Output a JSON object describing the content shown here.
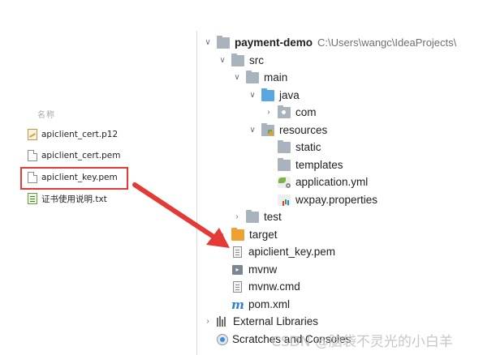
{
  "explorer": {
    "header": "名称",
    "files": [
      {
        "name": "apiclient_cert.p12",
        "icon": "certificate-icon"
      },
      {
        "name": "apiclient_cert.pem",
        "icon": "document-icon"
      },
      {
        "name": "apiclient_key.pem",
        "icon": "document-icon",
        "highlighted": true
      },
      {
        "name": "证书使用说明.txt",
        "icon": "text-file-icon"
      }
    ],
    "highlight_color": "#e53935"
  },
  "project": {
    "name": "payment-demo",
    "path": "C:\\Users\\wangc\\IdeaProjects\\",
    "items": {
      "src": "src",
      "main": "main",
      "java": "java",
      "com": "com",
      "resources": "resources",
      "static": "static",
      "templates": "templates",
      "application_yml": "application.yml",
      "wxpay_properties": "wxpay.properties",
      "test": "test",
      "target": "target",
      "apiclient_key": "apiclient_key.pem",
      "mvnw": "mvnw",
      "mvnw_cmd": "mvnw.cmd",
      "pom": "pom.xml",
      "external_libraries": "External Libraries",
      "scratches": "Scratches and Consoles"
    }
  },
  "watermark": "CSDN @脑袋不灵光的小白羊",
  "colors": {
    "arrow": "#e53935",
    "folder": "#a9b3bd",
    "source_folder": "#5aa6e0",
    "excluded_folder": "#f0a030"
  }
}
